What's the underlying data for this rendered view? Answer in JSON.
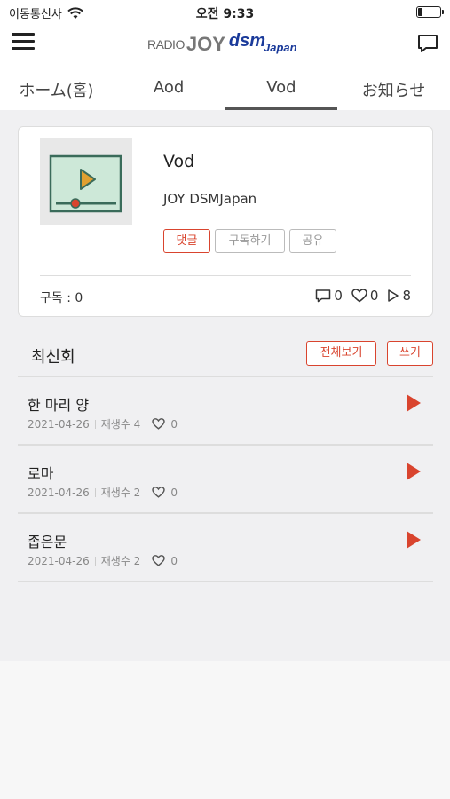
{
  "status_bar": {
    "carrier": "이동통신사",
    "time": "오전 9:33"
  },
  "logo": {
    "radio": "RADIO",
    "joy": "JOY",
    "dsm": "dsm",
    "japan": "Japan"
  },
  "tabs": [
    {
      "label": "ホーム(홈)"
    },
    {
      "label": "Aod"
    },
    {
      "label": "Vod"
    },
    {
      "label": "お知らせ"
    }
  ],
  "channel": {
    "title": "Vod",
    "name": "JOY DSMJapan",
    "buttons": {
      "comment": "댓글",
      "subscribe": "구독하기",
      "share": "공유"
    },
    "subscribers": "구독 : 0",
    "comment_count": "0",
    "like_count": "0",
    "play_count": "8"
  },
  "latest": {
    "title": "최신회",
    "view_all": "전체보기",
    "write": "쓰기",
    "items": [
      {
        "title": "한 마리 양",
        "date": "2021-04-26",
        "plays": "재생수 4",
        "likes": "0"
      },
      {
        "title": "로마",
        "date": "2021-04-26",
        "plays": "재생수 2",
        "likes": "0"
      },
      {
        "title": "좁은문",
        "date": "2021-04-26",
        "plays": "재생수 2",
        "likes": "0"
      }
    ]
  },
  "colors": {
    "accent": "#d9442e",
    "thumb_bg": "#cde8d8",
    "thumb_border": "#3a6b5a",
    "thumb_play": "#e0a030"
  }
}
